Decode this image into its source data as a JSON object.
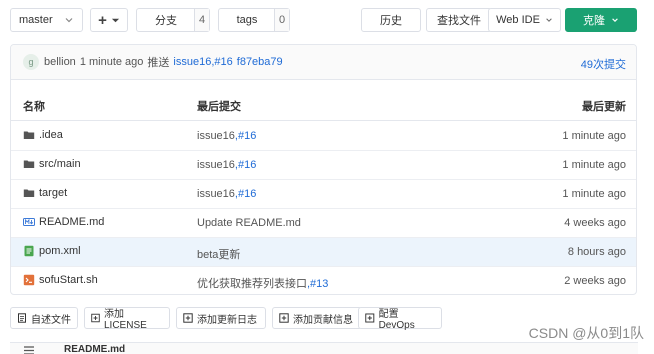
{
  "toolbar": {
    "branch": "master",
    "plus": "+",
    "branches_label": "分支",
    "branches_count": "4",
    "tags_label": "tags",
    "tags_count": "0",
    "history": "历史",
    "find_file": "查找文件",
    "web_ide": "Web IDE",
    "clone": "克隆"
  },
  "commit_bar": {
    "avatar_letter": "g",
    "author": "bellion",
    "time": "1 minute ago",
    "action": "推送",
    "branch_link": "issue16",
    "issue_link": ",#16",
    "sha": "f87eba79",
    "commit_count": "49次提交"
  },
  "table": {
    "headers": {
      "name": "名称",
      "last_commit": "最后提交",
      "last_update": "最后更新"
    },
    "rows": [
      {
        "icon": "folder-icon",
        "name": ".idea",
        "commit_text": "issue16",
        "commit_link": ",#16",
        "time": "1 minute ago",
        "highlight": false
      },
      {
        "icon": "folder-icon",
        "name": "src/main",
        "commit_text": "issue16",
        "commit_link": ",#16",
        "time": "1 minute ago",
        "highlight": false
      },
      {
        "icon": "folder-icon",
        "name": "target",
        "commit_text": "issue16",
        "commit_link": ",#16",
        "time": "1 minute ago",
        "highlight": false
      },
      {
        "icon": "markdown-icon",
        "name": "README.md",
        "commit_text": "Update README.md",
        "commit_link": "",
        "time": "4 weeks ago",
        "highlight": false
      },
      {
        "icon": "xml-file-icon",
        "name": "pom.xml",
        "commit_text": "beta更新",
        "commit_link": "",
        "time": "8 hours ago",
        "highlight": true
      },
      {
        "icon": "shell-file-icon",
        "name": "sofuStart.sh",
        "commit_text": "优化获取推荐列表接口",
        "commit_link": ",#13",
        "time": "2 weeks ago",
        "highlight": false
      }
    ]
  },
  "actions": {
    "readme": "自述文件",
    "license": "添加 LICENSE",
    "changelog": "添加更新日志",
    "contributing": "添加贡献信息",
    "devops": "配置 DevOps"
  },
  "readme_strip": {
    "label": "README.md"
  },
  "watermark": "CSDN @从0到1队",
  "colors": {
    "accent": "#1aa172",
    "link": "#1f6bd6",
    "highlight_row": "#ecf4fc"
  }
}
